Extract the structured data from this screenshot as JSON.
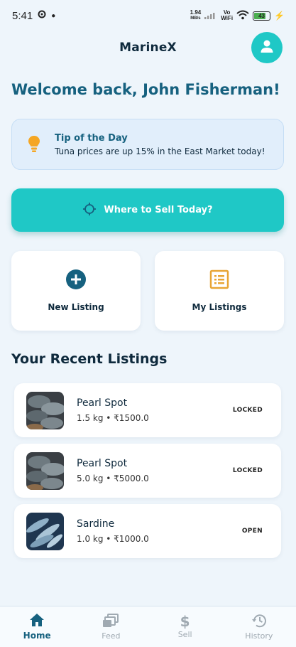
{
  "status_bar": {
    "time": "5:41",
    "net_rate_value": "1.94",
    "net_rate_unit": "MB/s",
    "volte_top": "Vo",
    "volte_bottom": "WiFi",
    "battery": "43"
  },
  "app_bar": {
    "title": "MarineX"
  },
  "welcome": "Welcome back, John Fisherman!",
  "tip": {
    "title": "Tip of the Day",
    "text": "Tuna prices are up 15% in the East Market today!"
  },
  "sell_button": {
    "label": "Where to Sell Today?"
  },
  "actions": {
    "new_listing": "New Listing",
    "my_listings": "My Listings"
  },
  "recent": {
    "title": "Your Recent Listings",
    "items": [
      {
        "name": "Pearl Spot",
        "meta": "1.5 kg • ₹1500.0",
        "status": "LOCKED"
      },
      {
        "name": "Pearl Spot",
        "meta": "5.0 kg • ₹5000.0",
        "status": "LOCKED"
      },
      {
        "name": "Sardine",
        "meta": "1.0 kg • ₹1000.0",
        "status": "OPEN"
      }
    ]
  },
  "bottom_nav": [
    {
      "label": "Home",
      "icon": "home-icon"
    },
    {
      "label": "Feed",
      "icon": "feed-icon"
    },
    {
      "label": "Sell",
      "icon": "dollar-icon"
    },
    {
      "label": "History",
      "icon": "history-icon"
    }
  ],
  "colors": {
    "accent": "#1fc8c6",
    "primary": "#16617f",
    "tip_bulb": "#f5a623",
    "listings_icon": "#e8a534",
    "background": "#eef5fb"
  }
}
